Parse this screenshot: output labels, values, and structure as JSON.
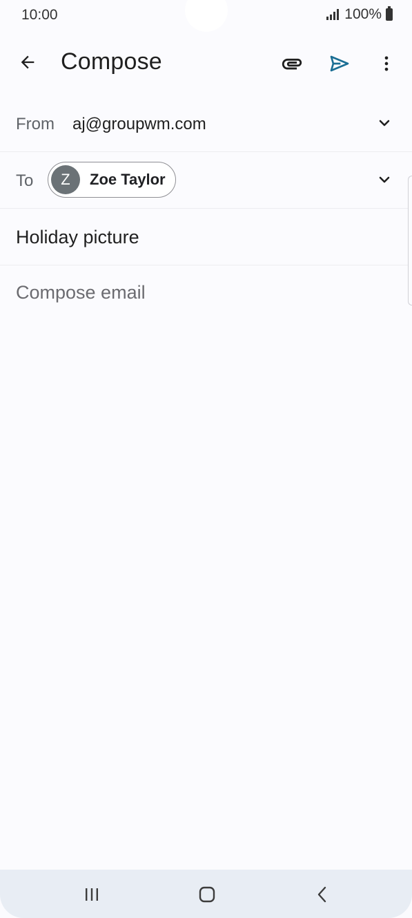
{
  "status_bar": {
    "time": "10:00",
    "battery_text": "100%",
    "icons": [
      "signal-icon",
      "battery-icon"
    ]
  },
  "toolbar": {
    "title": "Compose",
    "icons": [
      "back-arrow-icon",
      "paperclip-icon",
      "send-icon",
      "more-vert-icon"
    ],
    "accent_color": "#1a6e94"
  },
  "from": {
    "label": "From",
    "value": "aj@groupwm.com"
  },
  "to": {
    "label": "To",
    "recipient": {
      "initial": "Z",
      "name": "Zoe Taylor"
    }
  },
  "subject": {
    "value": "Holiday picture"
  },
  "body": {
    "placeholder": "Compose email"
  },
  "nav_bar": {
    "icons": [
      "recent-apps-icon",
      "home-icon",
      "back-chevron-icon"
    ]
  }
}
